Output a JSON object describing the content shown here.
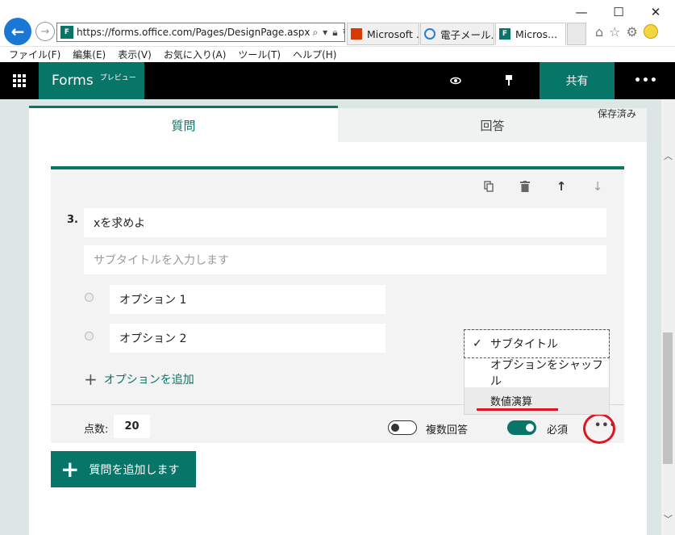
{
  "browser": {
    "url": "https://forms.office.com/Pages/DesignPage.aspx",
    "tabs": [
      {
        "label": "Microsoft ...",
        "icon": "office-icon",
        "active": false
      },
      {
        "label": "電子メール...",
        "icon": "ie-icon",
        "active": false
      },
      {
        "label": "Micros...",
        "icon": "forms-icon",
        "active": true
      }
    ],
    "menu": [
      "ファイル(F)",
      "編集(E)",
      "表示(V)",
      "お気に入り(A)",
      "ツール(T)",
      "ヘルプ(H)"
    ],
    "favicon": "F"
  },
  "header": {
    "brand": "Forms",
    "preview": "プレビュー",
    "share": "共有",
    "more": "•••"
  },
  "tabs": {
    "questions": "質問",
    "responses": "回答"
  },
  "status": "保存済み",
  "question": {
    "number": "3.",
    "title": "xを求めよ",
    "subtitle_placeholder": "サブタイトルを入力します",
    "options": [
      "オプション 1",
      "オプション 2"
    ],
    "add_option": "オプションを追加",
    "points_label": "点数:",
    "points": "20",
    "multiple_answers": "複数回答",
    "multiple_answers_on": false,
    "required": "必須",
    "required_on": true,
    "more": "•••"
  },
  "context_menu": {
    "items": [
      {
        "label": "サブタイトル",
        "checked": true
      },
      {
        "label": "オプションをシャッフル",
        "checked": false
      },
      {
        "label": "数値演算",
        "checked": false
      }
    ]
  },
  "add_question": "質問を追加します",
  "colors": {
    "accent": "#077568",
    "annotation": "#e0141e"
  }
}
